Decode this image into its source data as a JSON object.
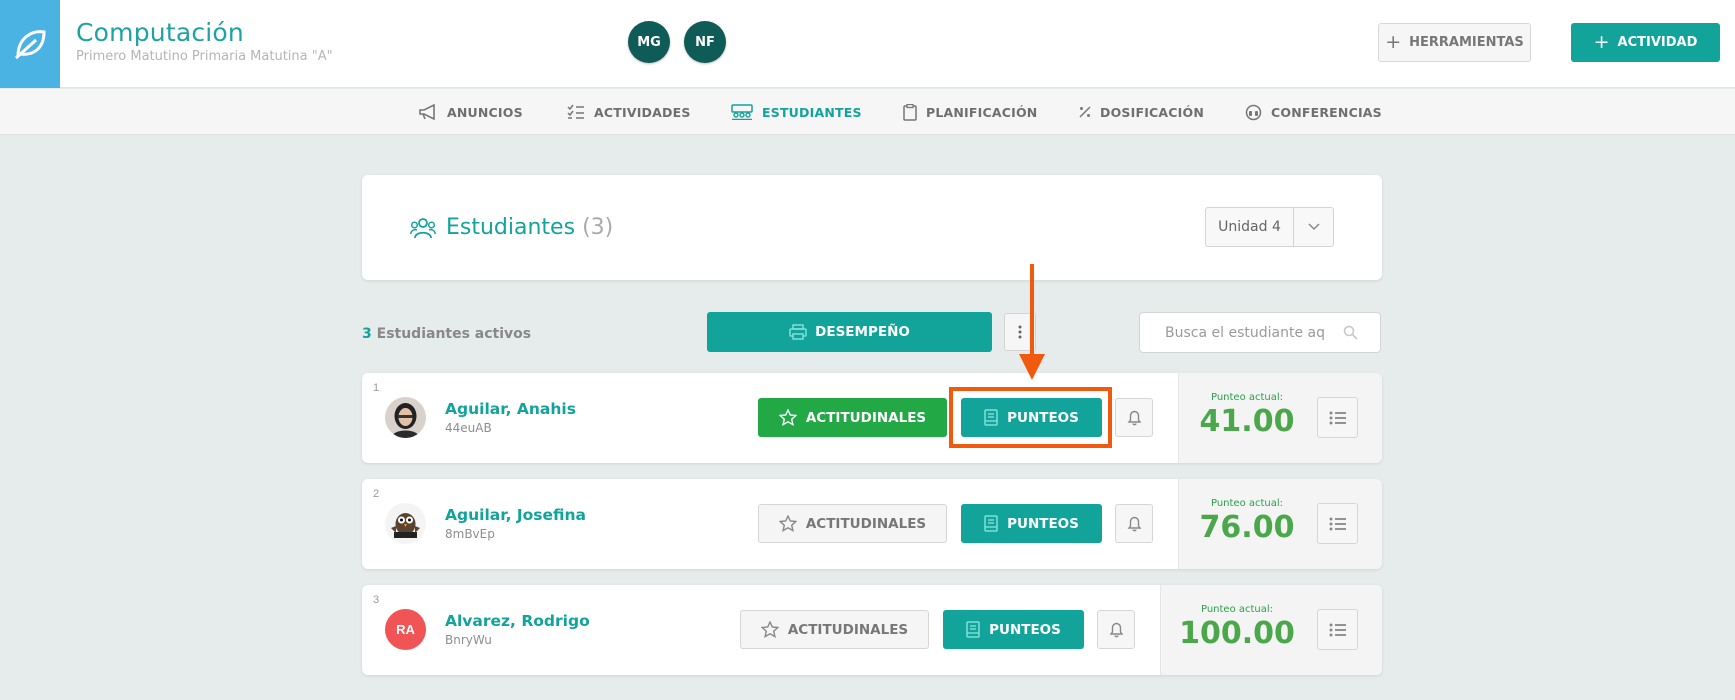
{
  "header": {
    "course_title": "Computación",
    "course_subtitle": "Primero Matutino Primaria Matutina \"A\"",
    "teachers": [
      "MG",
      "NF"
    ],
    "tools_label": "HERRAMIENTAS",
    "activity_label": "ACTIVIDAD",
    "logo_icon": "leaf-icon"
  },
  "nav": {
    "items": [
      {
        "label": "ANUNCIOS",
        "icon": "megaphone-icon"
      },
      {
        "label": "ACTIVIDADES",
        "icon": "checklist-icon"
      },
      {
        "label": "ESTUDIANTES",
        "icon": "students-icon",
        "active": true
      },
      {
        "label": "PLANIFICACIÓN",
        "icon": "clipboard-icon"
      },
      {
        "label": "DOSIFICACIÓN",
        "icon": "percent-icon"
      },
      {
        "label": "CONFERENCIAS",
        "icon": "headset-icon"
      }
    ]
  },
  "students_panel": {
    "title": "Estudiantes",
    "count": "(3)",
    "unit_selected": "Unidad 4",
    "active_count": "3",
    "active_label": "Estudiantes activos",
    "desempeno_label": "DESEMPEÑO",
    "search_placeholder": "Busca el estudiante aqu"
  },
  "students": [
    {
      "index": "1",
      "name": "Aguilar, Anahis",
      "code": "44euAB",
      "actitudinales_label": "ACTITUDINALES",
      "actitudinales_active": true,
      "punteos_label": "PUNTEOS",
      "score_label": "Punteo actual:",
      "score": "41.00",
      "avatar": "photo"
    },
    {
      "index": "2",
      "name": "Aguilar, Josefina",
      "code": "8mBvEp",
      "actitudinales_label": "ACTITUDINALES",
      "actitudinales_active": false,
      "punteos_label": "PUNTEOS",
      "score_label": "Punteo actual:",
      "score": "76.00",
      "avatar": "owl"
    },
    {
      "index": "3",
      "name": "Alvarez, Rodrigo",
      "code": "BnryWu",
      "actitudinales_label": "ACTITUDINALES",
      "actitudinales_active": false,
      "punteos_label": "PUNTEOS",
      "score_label": "Punteo actual:",
      "score": "100.00",
      "avatar": "initials",
      "initials": "RA"
    }
  ],
  "colors": {
    "primary": "#12a39b",
    "green": "#22a845",
    "score_green": "#4aa74a",
    "annotation": "#f15a0e",
    "logo_blue": "#4bb3e3",
    "avatar_red": "#f05454"
  }
}
